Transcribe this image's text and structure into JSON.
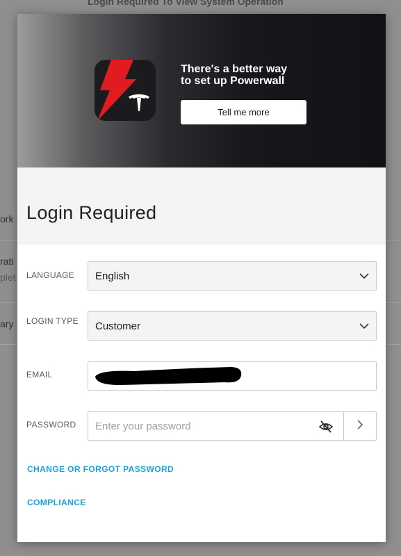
{
  "background": {
    "header": "Login Required To View System Operation",
    "fragments": [
      "ork",
      "rati",
      "plet",
      "ary"
    ]
  },
  "banner": {
    "headline_line1": "There's a better way",
    "headline_line2": "to set up Powerwall",
    "button_label": "Tell me more",
    "icon": "tesla-app-icon"
  },
  "login": {
    "title": "Login Required",
    "language_label": "LANGUAGE",
    "language_value": "English",
    "login_type_label": "LOGIN TYPE",
    "login_type_value": "Customer",
    "email_label": "EMAIL",
    "email_value": "",
    "password_label": "PASSWORD",
    "password_placeholder": "Enter your password",
    "password_toggle_icon": "eye-slash-icon",
    "submit_icon": "chevron-right-icon",
    "change_password_link": "CHANGE OR FORGOT PASSWORD",
    "compliance_link": "COMPLIANCE"
  },
  "colors": {
    "link": "#1ea2d4",
    "accent_red": "#e11b22"
  }
}
